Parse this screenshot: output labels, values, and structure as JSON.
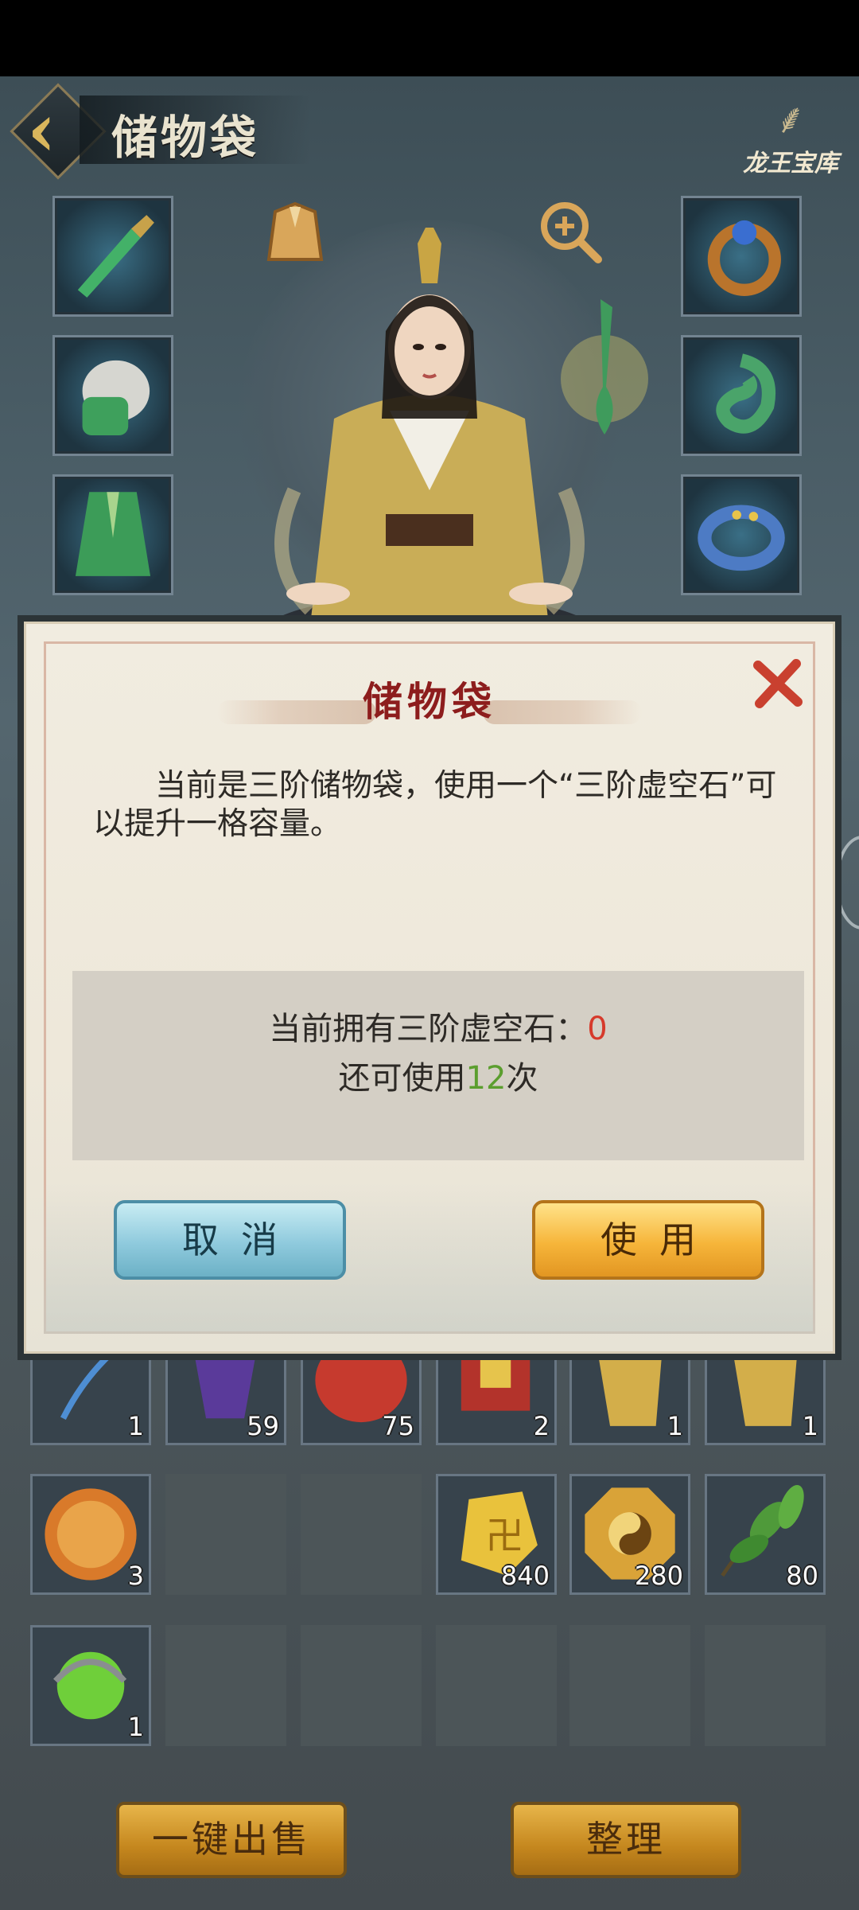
{
  "header": {
    "title": "储物袋",
    "logo_text": "龙王宝库",
    "back_icon": "chevron-left-icon"
  },
  "equipment": {
    "left_slots": [
      "sword-icon",
      "helmet-icon",
      "robe-icon"
    ],
    "right_slots": [
      "ring-icon",
      "jade-pendant-icon",
      "bracelet-icon"
    ],
    "top_icons": [
      "outfit-icon",
      "zoom-icon"
    ]
  },
  "inventory": {
    "rows": [
      [
        {
          "icon": "herb-icon",
          "count": "1"
        },
        {
          "icon": "purple-gem-icon",
          "count": "59"
        },
        {
          "icon": "red-pouch-icon",
          "count": "75"
        },
        {
          "icon": "red-box-icon",
          "count": "2"
        },
        {
          "icon": "gold-scroll-icon",
          "count": "1"
        },
        {
          "icon": "gold-scroll-icon",
          "count": "1"
        }
      ],
      [
        {
          "icon": "fire-orb-icon",
          "count": "3"
        },
        {
          "icon": "",
          "count": ""
        },
        {
          "icon": "",
          "count": ""
        },
        {
          "icon": "gold-stone-icon",
          "count": "840"
        },
        {
          "icon": "bagua-icon",
          "count": "280"
        },
        {
          "icon": "leaf-icon",
          "count": "80"
        }
      ],
      [
        {
          "icon": "green-orb-icon",
          "count": "1"
        },
        {
          "icon": "",
          "count": ""
        },
        {
          "icon": "",
          "count": ""
        },
        {
          "icon": "",
          "count": ""
        },
        {
          "icon": "",
          "count": ""
        },
        {
          "icon": "",
          "count": ""
        }
      ]
    ]
  },
  "bottom": {
    "sell_label": "一键出售",
    "sort_label": "整理"
  },
  "dialog": {
    "title": "储物袋",
    "description": "当前是三阶储物袋，使用一个“三阶虚空石”可以提升一格容量。",
    "owned_prefix": "当前拥有三阶虚空石：",
    "owned_count": "0",
    "remaining_prefix": "还可使用",
    "remaining_count": "12",
    "remaining_suffix": "次",
    "cancel_label": "取消",
    "use_label": "使用",
    "close_icon": "close-icon"
  },
  "colors": {
    "accent_red": "#d63a2b",
    "accent_green": "#5b9e2e",
    "title_red": "#8d1d1d"
  }
}
